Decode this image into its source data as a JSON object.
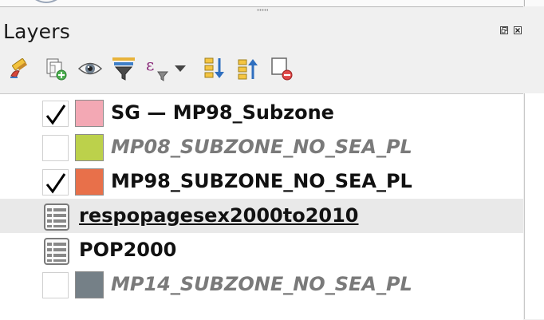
{
  "panel": {
    "title": "Layers"
  },
  "toolbar": {
    "buttons": [
      {
        "icon": "style-brush-icon"
      },
      {
        "icon": "add-group-icon"
      },
      {
        "icon": "manage-visibility-icon"
      },
      {
        "icon": "filter-legend-icon"
      },
      {
        "icon": "filter-expression-icon"
      },
      {
        "icon": "dropdown-arrow-icon"
      },
      {
        "icon": "expand-all-icon"
      },
      {
        "icon": "collapse-all-icon"
      },
      {
        "icon": "remove-layer-icon"
      }
    ]
  },
  "layers": [
    {
      "name": "SG — MP98_Subzone",
      "checked": true,
      "swatch": "#f3a8b4",
      "kind": "vector"
    },
    {
      "name": "MP08_SUBZONE_NO_SEA_PL",
      "checked": false,
      "swatch": "#bcd14b",
      "kind": "vector"
    },
    {
      "name": "MP98_SUBZONE_NO_SEA_PL",
      "checked": true,
      "swatch": "#e8704a",
      "kind": "vector"
    },
    {
      "name": "respopagesex2000to2010",
      "kind": "table",
      "selected": true
    },
    {
      "name": "POP2000",
      "kind": "table"
    },
    {
      "name": "MP14_SUBZONE_NO_SEA_PL",
      "checked": false,
      "swatch": "#758087",
      "kind": "vector"
    }
  ],
  "colors": {
    "tree_background": "#ffffff",
    "selected_row": "#e9e9e9",
    "disabled_text": "#7a7a7a"
  }
}
